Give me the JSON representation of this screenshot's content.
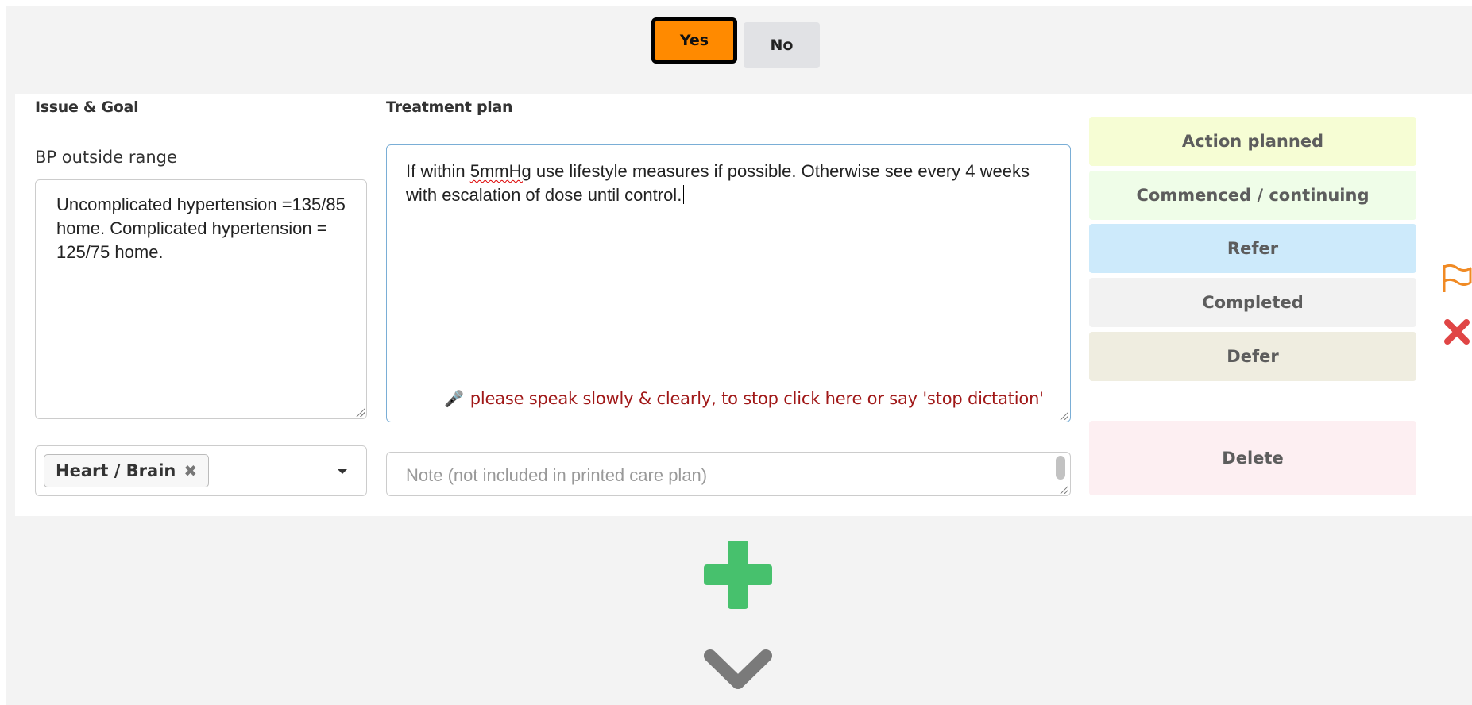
{
  "response": {
    "yes_label": "Yes",
    "no_label": "No"
  },
  "issue": {
    "section_label": "Issue & Goal",
    "name": "BP outside range",
    "goal_text": "Uncomplicated hypertension =135/85 home. Complicated hypertension = 125/75 home."
  },
  "plan": {
    "section_label": "Treatment plan",
    "text_before": "If within ",
    "text_misspelled": "5mmHg",
    "text_after": " use lifestyle measures if possible. Otherwise see every 4 weeks with escalation of dose until control.",
    "dictation_message": "please speak slowly & clearly, to stop click here or say 'stop dictation'"
  },
  "category": {
    "selected_tag": "Heart / Brain"
  },
  "note": {
    "placeholder": "Note (not included in printed care plan)"
  },
  "statuses": {
    "action_planned": "Action planned",
    "commenced": "Commenced / continuing",
    "refer": "Refer",
    "completed": "Completed",
    "defer": "Defer",
    "delete": "Delete"
  },
  "icons": {
    "flag": "flag-icon",
    "remove": "remove-icon",
    "add": "add-icon",
    "expand": "chevron-down-icon",
    "mic": "microphone-icon"
  },
  "colors": {
    "yes_active": "#ff8a00",
    "add_green": "#47c16d",
    "remove_red": "#e04545",
    "flag_orange": "#f08a24",
    "dictation_red": "#a01818"
  }
}
